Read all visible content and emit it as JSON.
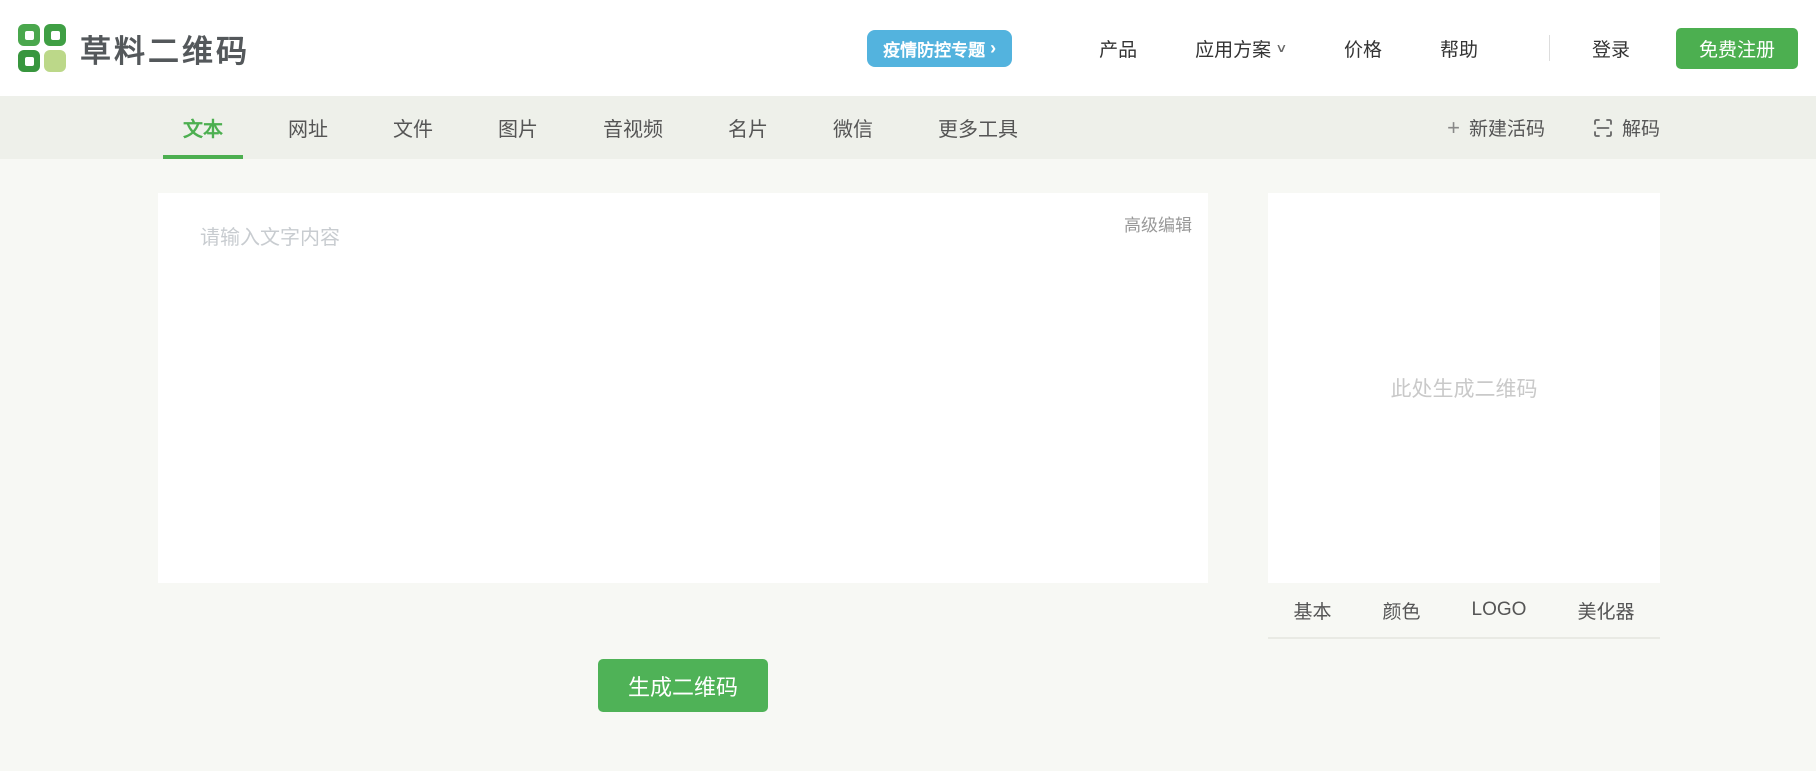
{
  "brand": {
    "name": "草料二维码"
  },
  "icons": {
    "plus": "+",
    "chevron_down": "∨",
    "arrow_right": "›"
  },
  "header": {
    "promo_badge": {
      "label": "疫情防控专题",
      "color": "#53b3de"
    },
    "nav": [
      {
        "label": "产品",
        "has_dropdown": false
      },
      {
        "label": "应用方案",
        "has_dropdown": true
      },
      {
        "label": "价格",
        "has_dropdown": false
      },
      {
        "label": "帮助",
        "has_dropdown": false
      }
    ],
    "login_label": "登录",
    "register_label": "免费注册",
    "register_color": "#4caf50"
  },
  "tabbar": {
    "tabs": [
      {
        "label": "文本",
        "active": true
      },
      {
        "label": "网址",
        "active": false
      },
      {
        "label": "文件",
        "active": false
      },
      {
        "label": "图片",
        "active": false
      },
      {
        "label": "音视频",
        "active": false
      },
      {
        "label": "名片",
        "active": false
      },
      {
        "label": "微信",
        "active": false
      },
      {
        "label": "更多工具",
        "active": false
      }
    ],
    "actions": [
      {
        "label": "新建活码",
        "icon": "plus-icon"
      },
      {
        "label": "解码",
        "icon": "scan-icon"
      }
    ],
    "active_color": "#4caf50"
  },
  "editor": {
    "value": "",
    "placeholder": "请输入文字内容",
    "advanced_edit_label": "高级编辑"
  },
  "preview": {
    "placeholder": "此处生成二维码",
    "tabs": [
      {
        "label": "基本"
      },
      {
        "label": "颜色"
      },
      {
        "label": "LOGO"
      },
      {
        "label": "美化器"
      }
    ]
  },
  "generate_button": {
    "label": "生成二维码",
    "color": "#4fb257"
  }
}
